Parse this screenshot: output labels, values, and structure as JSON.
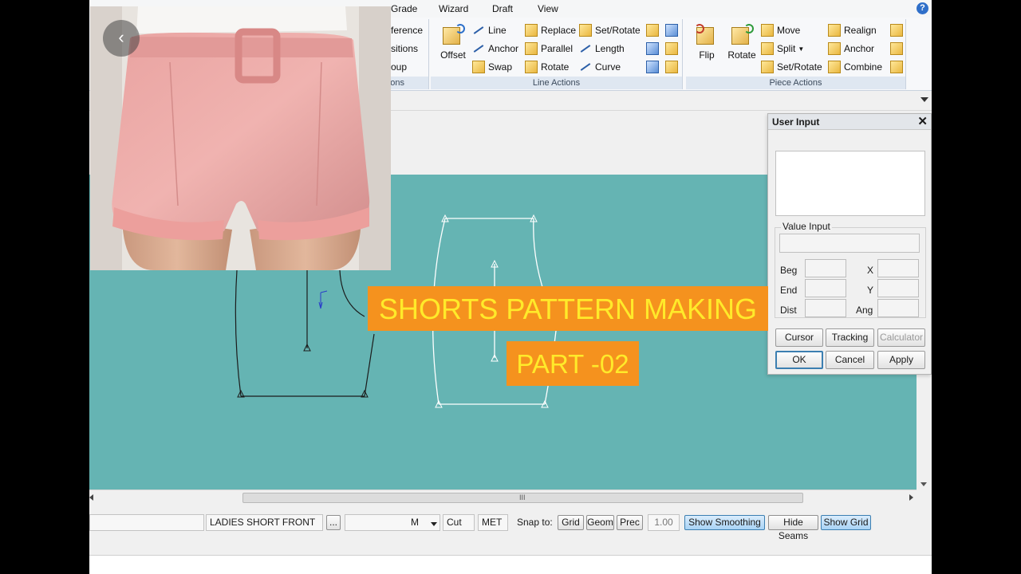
{
  "menubar": {
    "items": [
      "Grade",
      "Wizard",
      "Draft",
      "View"
    ],
    "help_icon": "help-icon"
  },
  "ribbon": {
    "group_partial": {
      "items": [
        "ference",
        "sitions",
        "oup"
      ],
      "label": "ons"
    },
    "line_actions": {
      "label": "Line Actions",
      "big_button": "Offset",
      "col1": [
        "Line",
        "Anchor",
        "Swap"
      ],
      "col2": [
        "Replace",
        "Parallel",
        "Rotate"
      ],
      "col3": [
        "Set/Rotate",
        "Length",
        "Curve"
      ]
    },
    "piece_actions": {
      "label": "Piece Actions",
      "big_buttons": [
        "Flip",
        "Rotate"
      ],
      "col1": [
        "Move",
        "Split",
        "Set/Rotate"
      ],
      "col2": [
        "Realign",
        "Anchor",
        "Combine"
      ]
    }
  },
  "dialog": {
    "title": "User Input",
    "value_input_label": "Value Input",
    "beg_label": "Beg",
    "end_label": "End",
    "dist_label": "Dist",
    "x_label": "X",
    "y_label": "Y",
    "ang_label": "Ang",
    "cursor_button": "Cursor",
    "tracking_button": "Tracking",
    "calculator_button": "Calculator",
    "ok_button": "OK",
    "cancel_button": "Cancel",
    "apply_button": "Apply"
  },
  "statusbar": {
    "piece_name": "LADIES SHORT FRONT",
    "browse_button": "...",
    "unit_select": "M",
    "cut_label": "Cut",
    "met_label": "MET",
    "snap_label": "Snap to:",
    "grid_button": "Grid",
    "geom_button": "Geom",
    "prec_button": "Prec",
    "prec_value": "1.00",
    "show_smoothing_button": "Show Smoothing",
    "hide_seams_button": "Hide Seams",
    "show_grid_button": "Show Grid"
  },
  "hscroll": {
    "grip": "III"
  },
  "overlay": {
    "back_button": "‹",
    "title": "SHORTS PATTERN MAKING",
    "subtitle": "PART -02"
  },
  "colors": {
    "canvas": "#65b4b3",
    "banner_bg": "#f5921e",
    "banner_text": "#ffea2a",
    "toggle_on": "#a9d3f5"
  }
}
